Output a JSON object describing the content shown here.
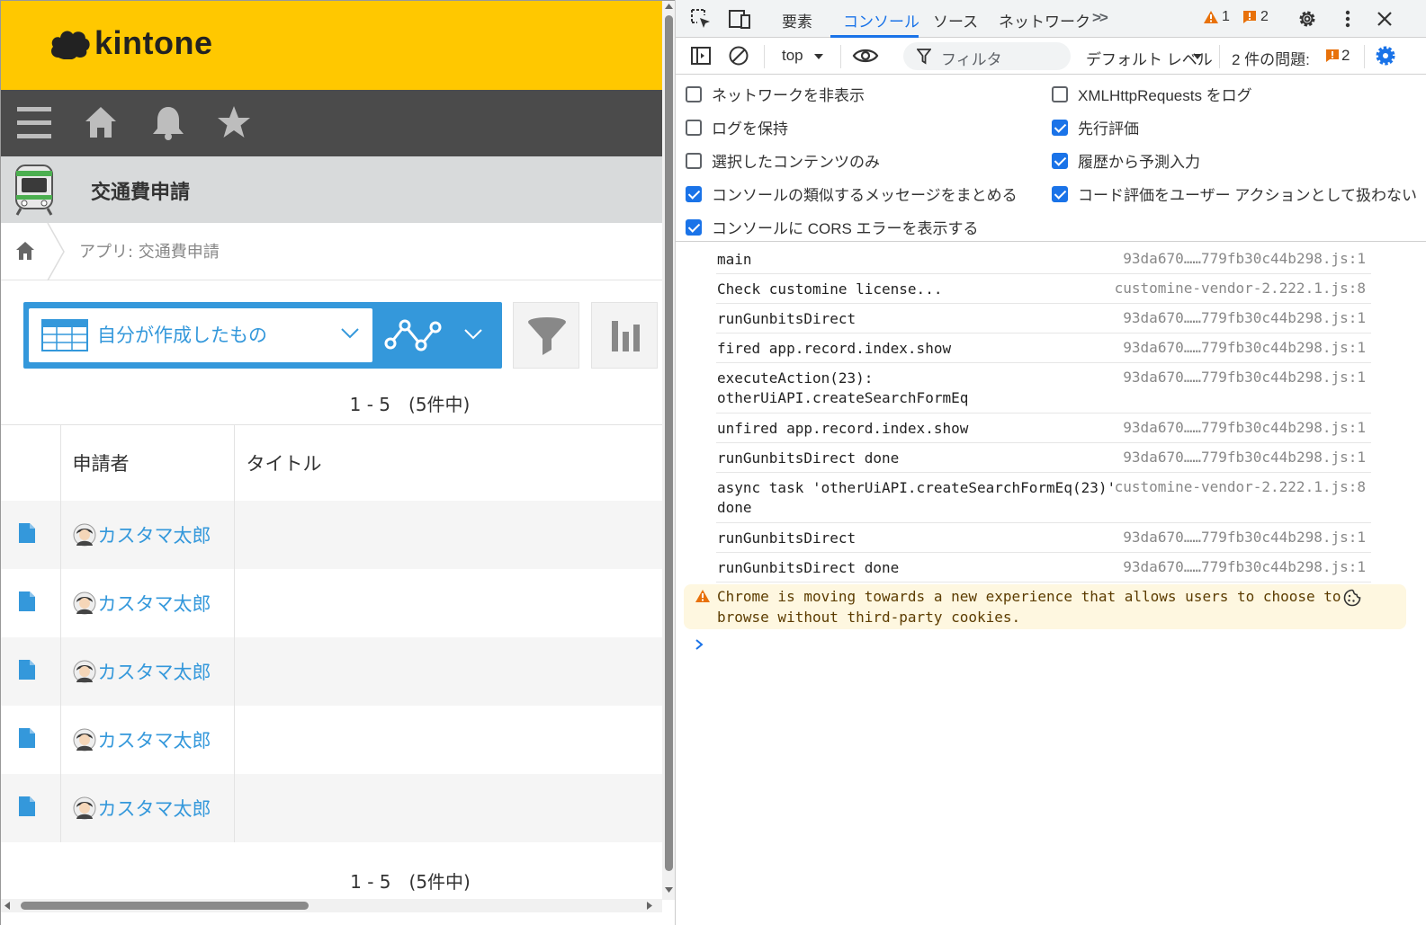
{
  "kintone": {
    "logo_text": "kintone",
    "nav": {
      "menu_icon": "hamburger-icon",
      "home_icon": "home-icon",
      "notify_icon": "bell-icon",
      "favorite_icon": "star-icon"
    },
    "app_title": "交通費申請",
    "breadcrumb": "アプリ: 交通費申請",
    "view_selector": "自分が作成したもの",
    "pager_top": "1 - 5　(5件中)",
    "pager_bottom": "1 - 5　(5件中)",
    "columns": [
      "申請者",
      "タイトル"
    ],
    "rows": [
      {
        "user": "カスタマ太郎",
        "title": ""
      },
      {
        "user": "カスタマ太郎",
        "title": ""
      },
      {
        "user": "カスタマ太郎",
        "title": ""
      },
      {
        "user": "カスタマ太郎",
        "title": ""
      },
      {
        "user": "カスタマ太郎",
        "title": ""
      }
    ],
    "colors": {
      "header": "#ffc800",
      "nav": "#4b4b4b",
      "accent": "#3498db"
    }
  },
  "devtools": {
    "tabs": [
      "要素",
      "コンソール",
      "ソース",
      "ネットワーク"
    ],
    "more_tabs": ">>",
    "active_tab": "コンソール",
    "warning_count": "1",
    "error_count": "2",
    "toolbar": {
      "context": "top",
      "filter_placeholder": "フィルタ",
      "level": "デフォルト レベル",
      "issues_label": "2 件の問題:",
      "issues_count": "2"
    },
    "settings_left": [
      {
        "label": "ネットワークを非表示",
        "checked": false
      },
      {
        "label": "ログを保持",
        "checked": false
      },
      {
        "label": "選択したコンテンツのみ",
        "checked": false
      },
      {
        "label": "コンソールの類似するメッセージをまとめる",
        "checked": true
      },
      {
        "label": "コンソールに CORS エラーを表示する",
        "checked": true
      }
    ],
    "settings_right": [
      {
        "label": "XMLHttpRequests をログ",
        "checked": false
      },
      {
        "label": "先行評価",
        "checked": true
      },
      {
        "label": "履歴から予測入力",
        "checked": true
      },
      {
        "label": "コード評価をユーザー アクションとして扱わない",
        "checked": true
      }
    ],
    "logs": [
      {
        "msg": "main",
        "src": "93da670……779fb30c44b298.js:1"
      },
      {
        "msg": "Check customine license...",
        "src": "customine-vendor-2.222.1.js:8"
      },
      {
        "msg": "runGunbitsDirect",
        "src": "93da670……779fb30c44b298.js:1"
      },
      {
        "msg": "fired app.record.index.show",
        "src": "93da670……779fb30c44b298.js:1"
      },
      {
        "msg": "executeAction(23):\notherUiAPI.createSearchFormEq",
        "src": "93da670……779fb30c44b298.js:1"
      },
      {
        "msg": "unfired app.record.index.show",
        "src": "93da670……779fb30c44b298.js:1"
      },
      {
        "msg": "runGunbitsDirect done",
        "src": "93da670……779fb30c44b298.js:1"
      },
      {
        "msg": "async task 'otherUiAPI.createSearchFormEq(23)'\ndone",
        "src": "customine-vendor-2.222.1.js:8"
      },
      {
        "msg": "runGunbitsDirect",
        "src": "93da670……779fb30c44b298.js:1"
      },
      {
        "msg": "runGunbitsDirect done",
        "src": "93da670……779fb30c44b298.js:1"
      }
    ],
    "warning_message": "Chrome is moving towards a new experience that allows users to choose to\nbrowse without third-party cookies.",
    "prompt_symbol": ">"
  }
}
